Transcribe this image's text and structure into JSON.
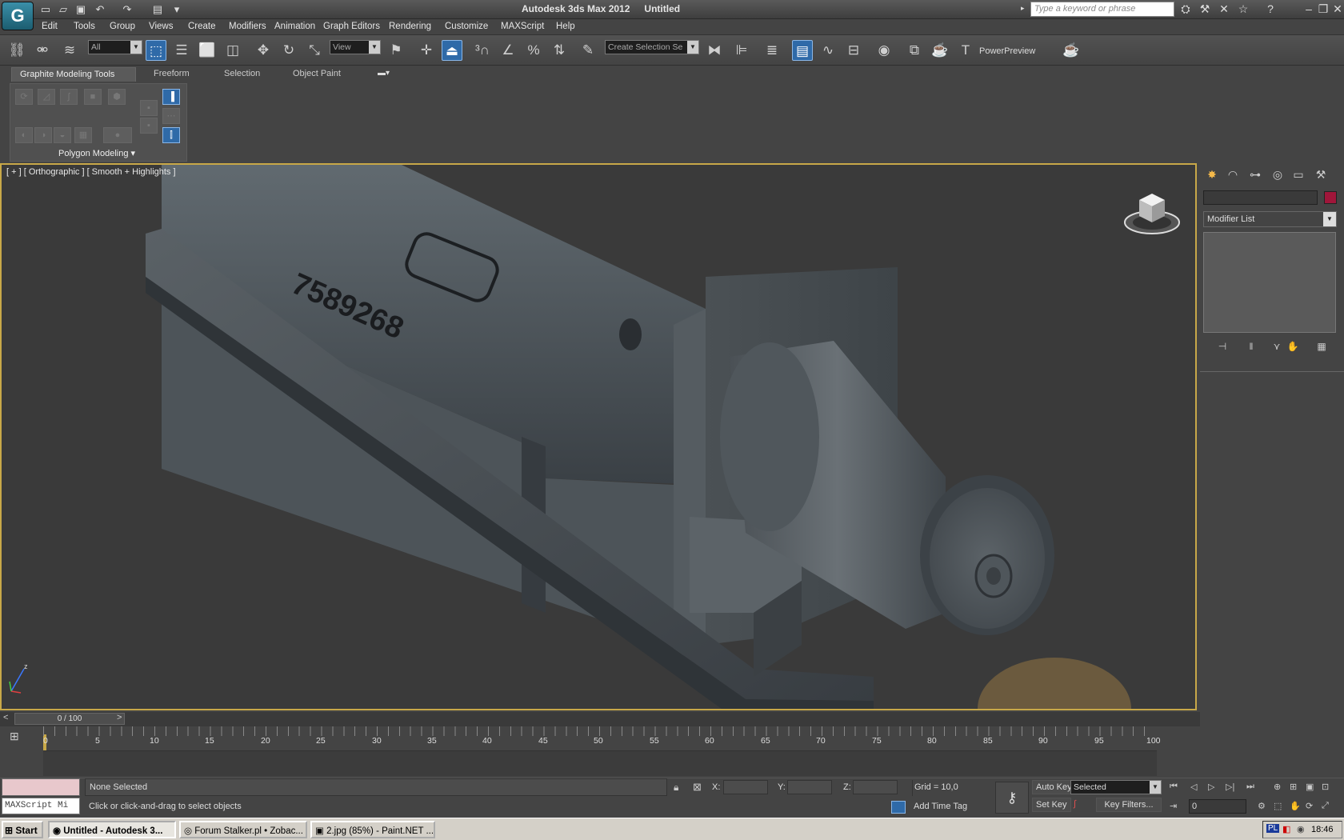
{
  "app": {
    "title": "Autodesk 3ds Max  2012",
    "document": "Untitled",
    "search_placeholder": "Type a keyword or phrase"
  },
  "menu": [
    "Edit",
    "Tools",
    "Group",
    "Views",
    "Create",
    "Modifiers",
    "Animation",
    "Graph Editors",
    "Rendering",
    "Customize",
    "MAXScript",
    "Help"
  ],
  "toolbar": {
    "filter_value": "All",
    "coord_value": "View",
    "selection_set_value": "Create Selection Se",
    "power_preview": "PowerPreview"
  },
  "ribbon": {
    "tabs": [
      "Graphite Modeling Tools",
      "Freeform",
      "Selection",
      "Object Paint"
    ],
    "panel_label": "Polygon Modeling"
  },
  "viewport": {
    "label": "[ + ] [ Orthographic ] [ Smooth + Highlights ]",
    "engraving": "7589268"
  },
  "command_panel": {
    "modifier_list": "Modifier List"
  },
  "timeline": {
    "slider": "0 / 100",
    "ticks": [
      "0",
      "5",
      "10",
      "15",
      "20",
      "25",
      "30",
      "35",
      "40",
      "45",
      "50",
      "55",
      "60",
      "65",
      "70",
      "75",
      "80",
      "85",
      "90",
      "95",
      "100"
    ]
  },
  "status": {
    "script_label": "MAXScript Mi",
    "selection": "None Selected",
    "prompt": "Click or click-and-drag to select objects",
    "x_label": "X:",
    "y_label": "Y:",
    "z_label": "Z:",
    "grid": "Grid = 10,0",
    "add_time_tag": "Add Time Tag",
    "auto_key": "Auto Key",
    "set_key": "Set Key",
    "key_mode": "Selected",
    "key_filters": "Key Filters...",
    "frame": "0"
  },
  "taskbar": {
    "start": "Start",
    "tasks": [
      "Untitled - Autodesk 3...",
      "Forum Stalker.pl • Zobac...",
      "2.jpg (85%) - Paint.NET ..."
    ],
    "tray_lang": "PL",
    "clock": "18:46"
  },
  "colors": {
    "viewport_border": "#c8a848",
    "active_blue": "#2f6aa8",
    "object_color": "#a0163a"
  }
}
